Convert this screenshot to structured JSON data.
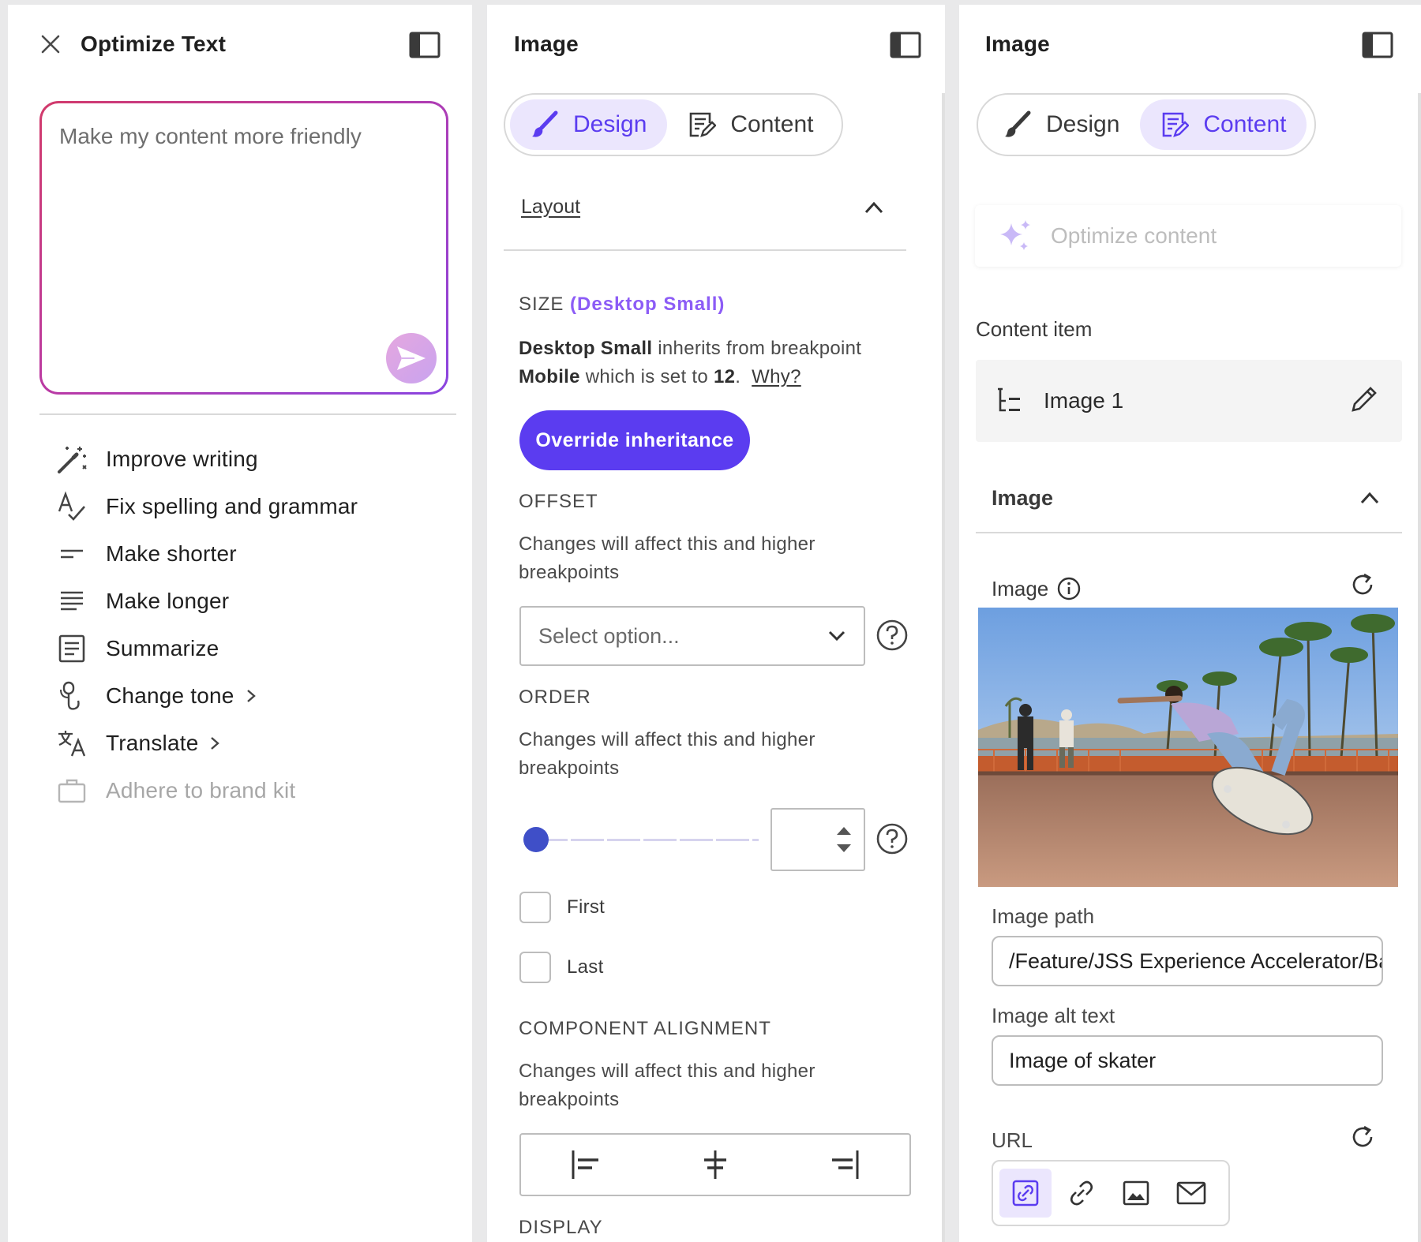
{
  "colors": {
    "accent": "#5b3cf0",
    "accent_light": "#ebe6fd",
    "size_highlight": "#8c5cf6",
    "gradient_start": "#d23a6a",
    "gradient_end": "#8a45e0"
  },
  "optimize_panel": {
    "title": "Optimize Text",
    "close_icon": "close-icon",
    "toggle_icon": "panel-toggle-icon",
    "prompt_placeholder": "Make my content more friendly",
    "prompt_value": "",
    "send_icon": "send-icon",
    "actions": [
      {
        "label": "Improve writing",
        "icon": "magic-wand-icon"
      },
      {
        "label": "Fix spelling and grammar",
        "icon": "spellcheck-icon"
      },
      {
        "label": "Make shorter",
        "icon": "short-lines-icon"
      },
      {
        "label": "Make longer",
        "icon": "long-lines-icon"
      },
      {
        "label": "Summarize",
        "icon": "summary-doc-icon"
      },
      {
        "label": "Change tone",
        "icon": "microphone-icon",
        "submenu": true
      },
      {
        "label": "Translate",
        "icon": "translate-icon",
        "submenu": true
      },
      {
        "label": "Adhere to brand kit",
        "icon": "briefcase-icon",
        "disabled": true
      }
    ]
  },
  "design_panel": {
    "title": "Image",
    "tabs": [
      {
        "label": "Design",
        "icon": "brush-icon",
        "active": true
      },
      {
        "label": "Content",
        "icon": "content-doc-icon",
        "active": false
      }
    ],
    "layout_label": "Layout",
    "size_caption": "SIZE",
    "size_breakpoint": "(Desktop Small)",
    "inherit_bold1": "Desktop Small",
    "inherit_text1": "inherits from breakpoint",
    "inherit_bold2": "Mobile",
    "inherit_text2": "which is set to",
    "inherit_value": "12",
    "inherit_period": ".",
    "why_link": "Why?",
    "override_button": "Override inheritance",
    "offset_caption": "OFFSET",
    "offset_desc": "Changes will affect this and higher breakpoints",
    "offset_select_placeholder": "Select option...",
    "order_caption": "ORDER",
    "order_desc": "Changes will affect this and higher breakpoints",
    "order_slider_value": 0,
    "order_number_value": "",
    "first_label": "First",
    "first_checked": false,
    "last_label": "Last",
    "last_checked": false,
    "alignment_caption": "COMPONENT ALIGNMENT",
    "alignment_desc": "Changes will affect this and higher breakpoints",
    "alignment_options": [
      "align-left-icon",
      "align-center-icon",
      "align-right-icon"
    ],
    "display_caption": "DISPLAY"
  },
  "content_panel": {
    "title": "Image",
    "tabs": [
      {
        "label": "Design",
        "icon": "brush-icon",
        "active": false
      },
      {
        "label": "Content",
        "icon": "content-doc-icon",
        "active": true
      }
    ],
    "optimize_label": "Optimize content",
    "content_item_label": "Content item",
    "content_item_name": "Image 1",
    "image_section_label": "Image",
    "image_field_label": "Image",
    "image_path_label": "Image path",
    "image_path_value": "/Feature/JSS Experience Accelerator/Basic Site",
    "image_alt_label": "Image alt text",
    "image_alt_value": "Image of skater",
    "url_label": "URL",
    "url_types": [
      {
        "icon": "internal-link-icon",
        "active": true
      },
      {
        "icon": "external-link-icon",
        "active": false
      },
      {
        "icon": "media-link-icon",
        "active": false
      },
      {
        "icon": "email-link-icon",
        "active": false
      }
    ]
  }
}
